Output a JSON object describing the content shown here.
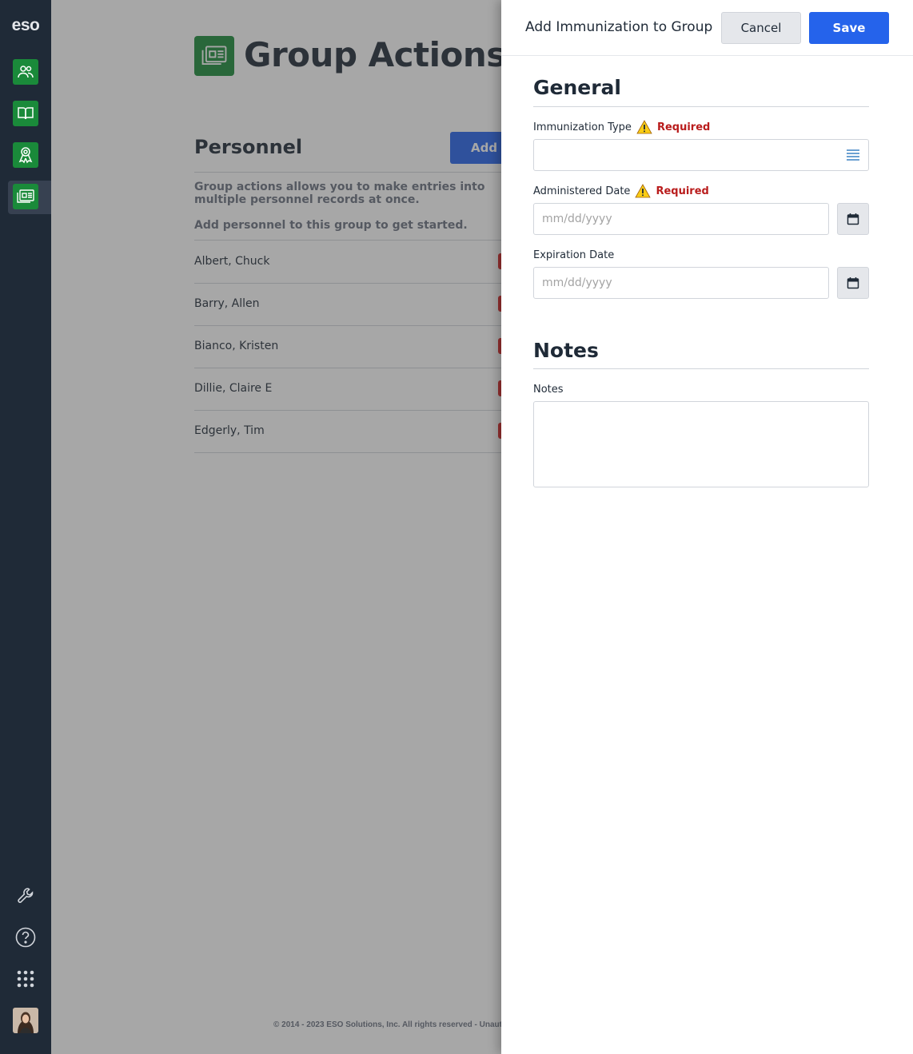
{
  "sidebar": {
    "logo": "eso",
    "nav": [
      {
        "icon": "people-icon"
      },
      {
        "icon": "book-icon"
      },
      {
        "icon": "award-icon"
      },
      {
        "icon": "group-actions-icon",
        "active": true
      }
    ],
    "bottom": [
      {
        "icon": "wrench-icon"
      },
      {
        "icon": "help-icon"
      },
      {
        "icon": "apps-grid-icon"
      },
      {
        "icon": "user-avatar"
      }
    ]
  },
  "main": {
    "title": "Group Actions",
    "section_title": "Personnel",
    "add_label": "Add",
    "help_text_1": "Group actions allows you to make entries into multiple personnel records at once.",
    "help_text_2": "Add personnel to this group to get started.",
    "personnel": [
      {
        "name": "Albert, Chuck"
      },
      {
        "name": "Barry, Allen"
      },
      {
        "name": "Bianco, Kristen"
      },
      {
        "name": "Dillie, Claire E"
      },
      {
        "name": "Edgerly, Tim"
      }
    ],
    "footer": "© 2014 - 2023 ESO Solutions, Inc. All rights reserved - Unaut"
  },
  "panel": {
    "title": "Add Immunization to Group",
    "cancel_label": "Cancel",
    "save_label": "Save",
    "general_title": "General",
    "immunization_type_label": "Immunization Type",
    "required_label": "Required",
    "administered_date_label": "Administered Date",
    "date_placeholder": "mm/dd/yyyy",
    "expiration_date_label": "Expiration Date",
    "notes_title": "Notes",
    "notes_label": "Notes"
  },
  "colors": {
    "sidebar_bg": "#1f2a37",
    "accent_green": "#1a8a3a",
    "primary_blue": "#2563eb",
    "required_red": "#b91c1c",
    "warning_yellow": "#facc15"
  }
}
